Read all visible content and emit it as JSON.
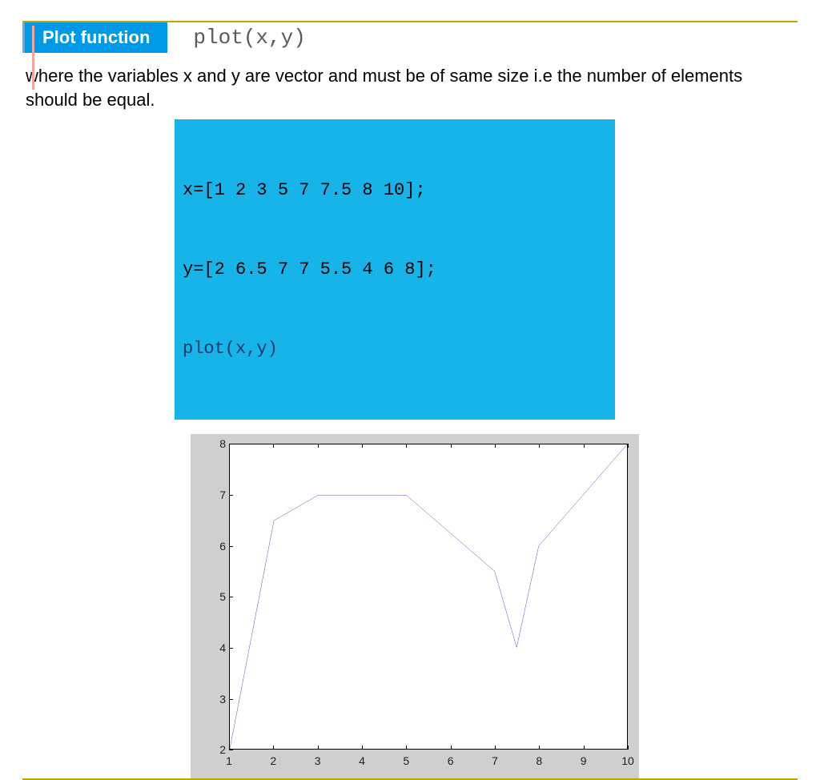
{
  "header": {
    "badge": "Plot function",
    "command": "plot(x,y)"
  },
  "description": "where the variables x and y are vector and must be of same size i.e the number of elements should be equal.",
  "code": {
    "line1": "x=[1 2 3 5 7 7.5 8 10];",
    "line2": "y=[2 6.5 7 7 5.5 4 6 8];",
    "line3": "plot(x,y)"
  },
  "chart_data": {
    "type": "line",
    "x": [
      1,
      2,
      3,
      5,
      7,
      7.5,
      8,
      10
    ],
    "y": [
      2,
      6.5,
      7,
      7,
      5.5,
      4,
      6,
      8
    ],
    "xlim": [
      1,
      10
    ],
    "ylim": [
      2,
      8
    ],
    "xticks": [
      1,
      2,
      3,
      4,
      5,
      6,
      7,
      8,
      9,
      10
    ],
    "yticks": [
      2,
      3,
      4,
      5,
      6,
      7,
      8
    ],
    "title": "",
    "xlabel": "",
    "ylabel": ""
  }
}
